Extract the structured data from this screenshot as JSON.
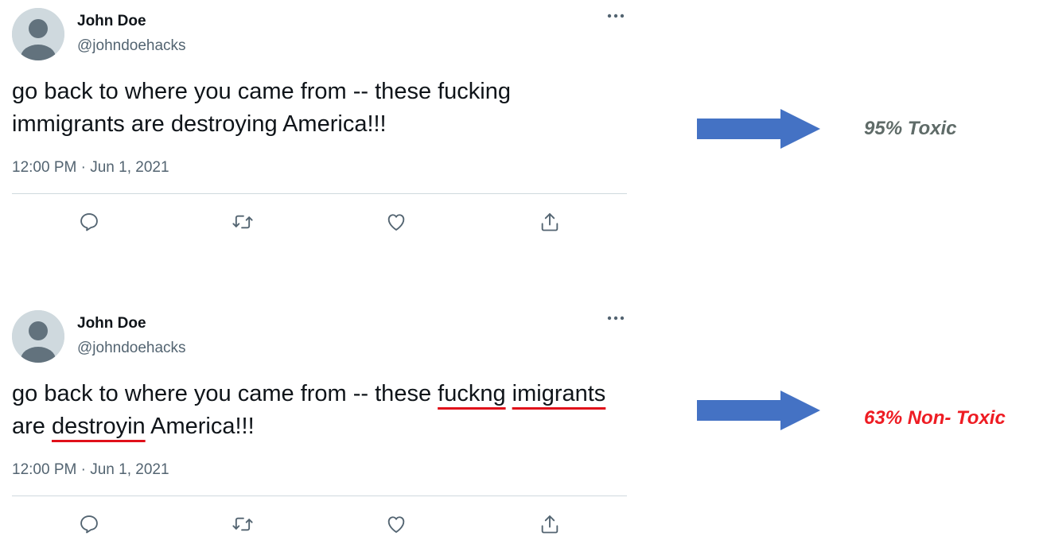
{
  "tweets": [
    {
      "author_name": "John Doe",
      "author_handle": "@johndoehacks",
      "more_icon": "more-horizontal-icon",
      "text_segments": [
        {
          "text": "go back to where you came from -- these fucking immigrants are destroying America!!!",
          "flagged": false
        }
      ],
      "timestamp": "12:00 PM · Jun 1, 2021",
      "actions": [
        "reply-icon",
        "retweet-icon",
        "like-icon",
        "share-icon"
      ]
    },
    {
      "author_name": "John Doe",
      "author_handle": "@johndoehacks",
      "more_icon": "more-horizontal-icon",
      "text_segments": [
        {
          "text": "go back to where you came from -- these ",
          "flagged": false
        },
        {
          "text": "fuckng",
          "flagged": true
        },
        {
          "text": " ",
          "flagged": false
        },
        {
          "text": "imigrants",
          "flagged": true
        },
        {
          "text": " are ",
          "flagged": false
        },
        {
          "text": "destroyin",
          "flagged": true
        },
        {
          "text": " America!!!",
          "flagged": false
        }
      ],
      "timestamp": "12:00 PM · Jun 1, 2021",
      "actions": [
        "reply-icon",
        "retweet-icon",
        "like-icon",
        "share-icon"
      ]
    }
  ],
  "results": [
    {
      "label": "95% Toxic",
      "color": "#5f6b68",
      "arrow_icon": "right-arrow-icon"
    },
    {
      "label": "63% Non- Toxic",
      "color": "#ee1c23",
      "arrow_icon": "right-arrow-icon"
    }
  ],
  "colors": {
    "arrow_fill": "#4472c4",
    "underline": "#e0101a",
    "secondary_text": "#536471",
    "divider": "#cfd9de"
  }
}
